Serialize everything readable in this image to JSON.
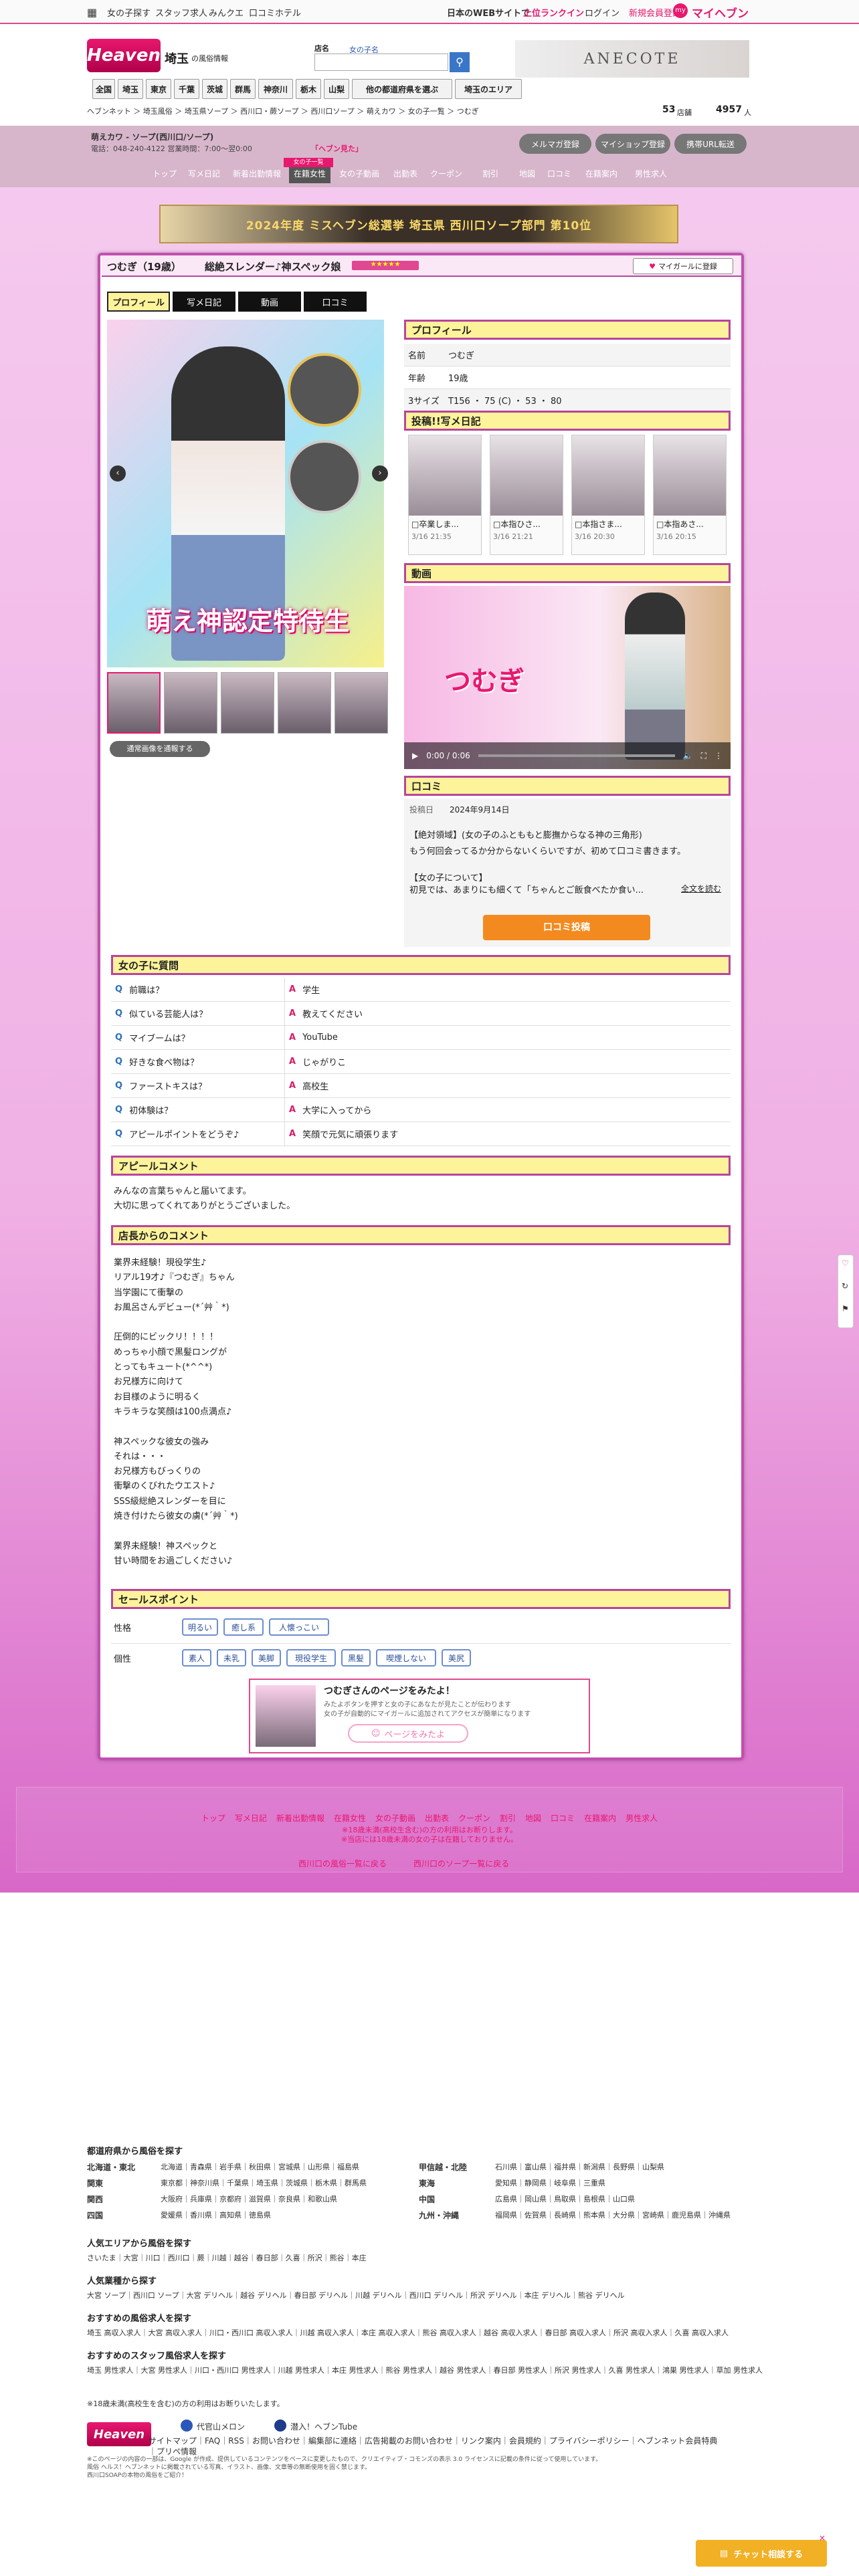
{
  "global": {
    "links": [
      "女の子探す",
      "スタッフ求人",
      "みんクエ",
      "口コミホテル"
    ],
    "right_text": "日本のWEBサイトで",
    "right_highlight": "上位ランクイン",
    "login": "ログイン",
    "register": "新規会員登録",
    "my": "マイヘブン"
  },
  "header": {
    "logo": "Heaven",
    "region": "埼玉",
    "region_sub": "の風俗情報",
    "search_label": "店名",
    "search_placeholder": "女の子名",
    "banner": "ANECOTE",
    "tabs": [
      "全国",
      "埼玉",
      "東京",
      "千葉",
      "茨城",
      "群馬",
      "神奈川",
      "栃木",
      "山梨",
      "他の都道府県を選ぶ",
      "埼玉のエリア"
    ],
    "breadcrumb": "ヘブンネット ＞ 埼玉風俗 ＞ 埼玉県ソープ ＞ 西川口・蕨ソープ ＞ 西川口ソープ ＞ 萌えカワ ＞ 女の子一覧 ＞ つむぎ",
    "count_now": "53",
    "count_now_label": "店舗",
    "count_total": "4957",
    "count_total_label": "人"
  },
  "shop": {
    "name": "萌えカワ - ソープ(西川口/ソープ)",
    "tel": "電話：048-240-4122 営業時間：7:00～翌0:00",
    "tel_note": "「ヘブン見た」",
    "buttons": [
      "メルマガ登録",
      "マイショップ登録",
      "携帯URL転送"
    ],
    "tabs": [
      "トップ",
      "写メ日記",
      "新着出勤情報",
      "在籍女性",
      "女の子動画",
      "出勤表",
      "クーポン",
      "割引",
      "地図",
      "口コミ",
      "在籍案内",
      "男性求人"
    ],
    "hot_badge": "女の子一覧",
    "banner": "2024年度 ミスヘブン総選挙 埼玉県 西川口ソープ部門 第10位"
  },
  "girl": {
    "name": "つむぎ（19歳）",
    "catch": "総絶スレンダー♪神スペック娘",
    "add_btn": "マイガールに登録",
    "tabs": [
      "プロフィール",
      "写メ日記",
      "動画",
      "口コミ"
    ],
    "photo_text": "萌え神認定特待生",
    "photo_btn": "通常画像を通報する"
  },
  "profile": {
    "title": "プロフィール",
    "rows": [
      {
        "k": "名前",
        "v": "つむぎ"
      },
      {
        "k": "年齢",
        "v": "19歳"
      },
      {
        "k": "3サイズ",
        "v": "T156 ・ 75 (C) ・ 53 ・ 80"
      }
    ]
  },
  "diary": {
    "title": "投稿!!写メ日記",
    "items": [
      {
        "t": "□卒業しま...",
        "d": "3/16 21:35"
      },
      {
        "t": "□本指ひさ...",
        "d": "3/16 21:21"
      },
      {
        "t": "□本指さま...",
        "d": "3/16 20:30"
      },
      {
        "t": "□本指あさ...",
        "d": "3/16 20:15"
      }
    ]
  },
  "video": {
    "title": "動画",
    "time": "0:00 / 0:06",
    "text": "つむぎ"
  },
  "review": {
    "title": "口コミ",
    "date_label": "投稿日",
    "date": "2024年9月14日",
    "headline": "【絶対領域】(女の子のふとももと膨撫からなる神の三角形)",
    "line1": "もう何回会ってるか分からないくらいですが、初めて口コミ書きます。",
    "line2": "【女の子について】",
    "line3": "初見では、あまりにも細くて「ちゃんとご飯食べたか食い...",
    "more": "全文を読む",
    "btn": "口コミ投稿"
  },
  "qa": {
    "title": "女の子に質問",
    "items": [
      {
        "q": "前職は？",
        "a": "学生"
      },
      {
        "q": "似ている芸能人は？",
        "a": "教えてください"
      },
      {
        "q": "マイブームは？",
        "a": "YouTube"
      },
      {
        "q": "好きな食べ物は？",
        "a": "じゃがりこ"
      },
      {
        "q": "ファーストキスは？",
        "a": "高校生"
      },
      {
        "q": "初体験は？",
        "a": "大学に入ってから"
      },
      {
        "q": "アピールポイントをどうぞ♪",
        "a": "笑顔で元気に頑張ります"
      }
    ]
  },
  "appeal": {
    "title": "アピールコメント",
    "lines": [
      "みんなの言葉ちゃんと届いてます。",
      "大切に思ってくれてありがとうございました。"
    ]
  },
  "manager": {
    "title": "店長からのコメント",
    "lines": [
      "業界未経験！現役学生♪",
      "リアル19才♪『つむぎ』ちゃん",
      "当学園にて衝撃の",
      "お風呂さんデビュー(*´艸｀*)",
      "",
      "圧倒的にビックリ！！！！",
      "めっちゃ小顔で黒髪ロングが",
      "とってもキュート(*^^*)",
      "お兄様方に向けて",
      "お目様のように明るく",
      "キラキラな笑顔は100点満点♪",
      "",
      "神スペックな彼女の強み",
      "それは・・・",
      "お兄様方もびっくりの",
      "衝撃のくびれたウエスト♪",
      "SSS級総絶スレンダーを目に",
      "焼き付けたら彼女の虜(*´艸｀*)",
      "",
      "業界未経験！神スペックと",
      "甘い時間をお過ごしください♪"
    ]
  },
  "sales": {
    "title": "セールスポイント",
    "k1": "性格",
    "v1": [
      "明るい",
      "癒し系",
      "人懐っこい"
    ],
    "k2": "個性",
    "v2": [
      "素人",
      "未乳",
      "美脚",
      "現役学生",
      "黒髪",
      "喫煙しない",
      "美尻"
    ]
  },
  "promo": {
    "title": "つむぎさんのページをみたよ！",
    "sub1": "みたよボタンを押すと女の子にあなたが見たことが伝わります",
    "sub2": "女の子が自動的にマイガールに追加されてアクセスが簡単になります",
    "btn": "ページをみたよ"
  },
  "bottom_nav": {
    "links": [
      "トップ",
      "写メ日記",
      "新着出勤情報",
      "在籍女性",
      "女の子動画",
      "出勤表",
      "クーポン",
      "割引",
      "地図",
      "口コミ",
      "在籍案内",
      "男性求人"
    ],
    "note1": "※18歳未満(高校生含む)の方の利用はお断りします。",
    "note2": "※当店には18歳未満の女の子は在籍しておりません。",
    "back1": "西川口の風俗一覧に戻る",
    "back2": "西川口のソープ一覧に戻る"
  },
  "footer": {
    "h_pref": "都道府県から風俗を探す",
    "regions": [
      {
        "k": "北海道・東北",
        "v": "北海道｜青森県｜岩手県｜秋田県｜宮城県｜山形県｜福島県"
      },
      {
        "k": "関東",
        "v": "東京都｜神奈川県｜千葉県｜埼玉県｜茨城県｜栃木県｜群馬県"
      },
      {
        "k": "関西",
        "v": "大阪府｜兵庫県｜京都府｜滋賀県｜奈良県｜和歌山県"
      },
      {
        "k": "四国",
        "v": "愛媛県｜香川県｜高知県｜徳島県"
      },
      {
        "k": "甲信越・北陸",
        "v": "石川県｜富山県｜福井県｜新潟県｜長野県｜山梨県"
      },
      {
        "k": "東海",
        "v": "愛知県｜静岡県｜岐阜県｜三重県"
      },
      {
        "k": "中国",
        "v": "広島県｜岡山県｜鳥取県｜島根県｜山口県"
      },
      {
        "k": "九州・沖縄",
        "v": "福岡県｜佐賀県｜長崎県｜熊本県｜大分県｜宮崎県｜鹿児島県｜沖縄県"
      }
    ],
    "h_area": "人気エリアから風俗を探す",
    "area": "さいたま｜大宮｜川口｜西川口｜蕨｜川越｜越谷｜春日部｜久喜｜所沢｜熊谷｜本庄",
    "h_genre": "人気業種から探す",
    "genre": "大宮 ソープ｜西川口 ソープ｜大宮 デリヘル｜越谷 デリヘル｜春日部 デリヘル｜川越 デリヘル｜西川口 デリヘル｜所沢 デリヘル｜本庄 デリヘル｜熊谷 デリヘル",
    "h_job": "おすすめの風俗求人を探す",
    "job": "埼玉 高収入求人｜大宮 高収入求人｜川口・西川口 高収入求人｜川越 高収入求人｜本庄 高収入求人｜熊谷 高収入求人｜越谷 高収入求人｜春日部 高収入求人｜所沢 高収入求人｜久喜 高収入求人",
    "h_staff": "おすすめのスタッフ風俗求人を探す",
    "staff": "埼玉 男性求人｜大宮 男性求人｜川口・西川口 男性求人｜川越 男性求人｜本庄 男性求人｜熊谷 男性求人｜越谷 男性求人｜春日部 男性求人｜所沢 男性求人｜久喜 男性求人｜鴻巣 男性求人｜草加 男性求人",
    "age_note": "※18歳未満(高校生を含む)の方の利用はお断りいたします。",
    "logo": "Heaven",
    "promo1": "代官山メロン",
    "promo2": "潜入！ヘブンTube",
    "links": "サイトマップ｜FAQ｜RSS｜お問い合わせ｜編集部に連絡｜広告掲載のお問い合わせ｜リンク案内｜会員規約｜プライバシーポリシー｜ヘブンネット会員特典｜プリペ情報",
    "copy1": "※このページの内容の一部は、Google が作成、提供しているコンテンツをベースに変更したもので、クリエイティブ・コモンズの表示 3.0 ライセンスに記載の条件に従って使用しています。",
    "copy2": "風俗 ヘルス！ヘブンネットに掲載されている写真、イラスト、画像、文章等の無断使用を固く禁じます。",
    "copy3": "西川口SOAPの本物の風俗をご紹介！",
    "chat": "チャット相談する"
  },
  "colors": {
    "brand": "#e8186f",
    "frame": "#b8449d",
    "section_fill": "#fcf39a"
  }
}
